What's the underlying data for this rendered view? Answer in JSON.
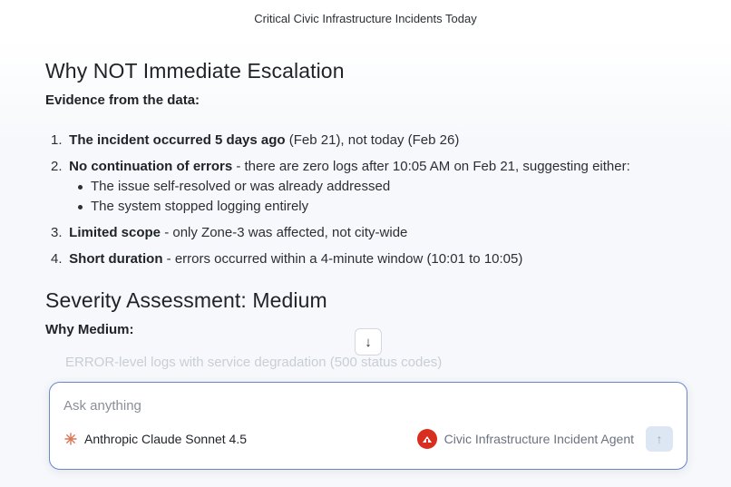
{
  "header": {
    "title": "Critical Civic Infrastructure Incidents Today"
  },
  "content": {
    "heading1": "Why NOT Immediate Escalation",
    "subheading1": "Evidence from the data:",
    "items": [
      {
        "num": "1.",
        "bold": "The incident occurred 5 days ago",
        "rest": " (Feb 21), not today (Feb 26)"
      },
      {
        "num": "2.",
        "bold": "No continuation of errors",
        "rest": " - there are zero logs after 10:05 AM on Feb 21, suggesting either:"
      },
      {
        "num": "3.",
        "bold": "Limited scope",
        "rest": " - only Zone-3 was affected, not city-wide"
      },
      {
        "num": "4.",
        "bold": "Short duration",
        "rest": " - errors occurred within a 4-minute window (10:01 to 10:05)"
      }
    ],
    "subitems": [
      "The issue self-resolved or was already addressed",
      "The system stopped logging entirely"
    ],
    "heading2": "Severity Assessment: Medium",
    "subheading2": "Why Medium:",
    "faded_line": "ERROR-level logs with service degradation (500 status codes)"
  },
  "scroll_button": {
    "label": "↓"
  },
  "composer": {
    "placeholder": "Ask anything",
    "model_label": "Anthropic Claude Sonnet 4.5",
    "agent_label": "Civic Infrastructure Incident Agent",
    "send_label": "↑"
  },
  "icons": {
    "model": "claude-spark-icon",
    "agent": "civic-agent-badge-icon",
    "send": "arrow-up-icon",
    "scroll": "arrow-down-icon"
  },
  "colors": {
    "accent_border": "#6b87c8",
    "agent_badge": "#d92d20",
    "spark": "#d97757",
    "send_bg": "#dde6f3"
  }
}
